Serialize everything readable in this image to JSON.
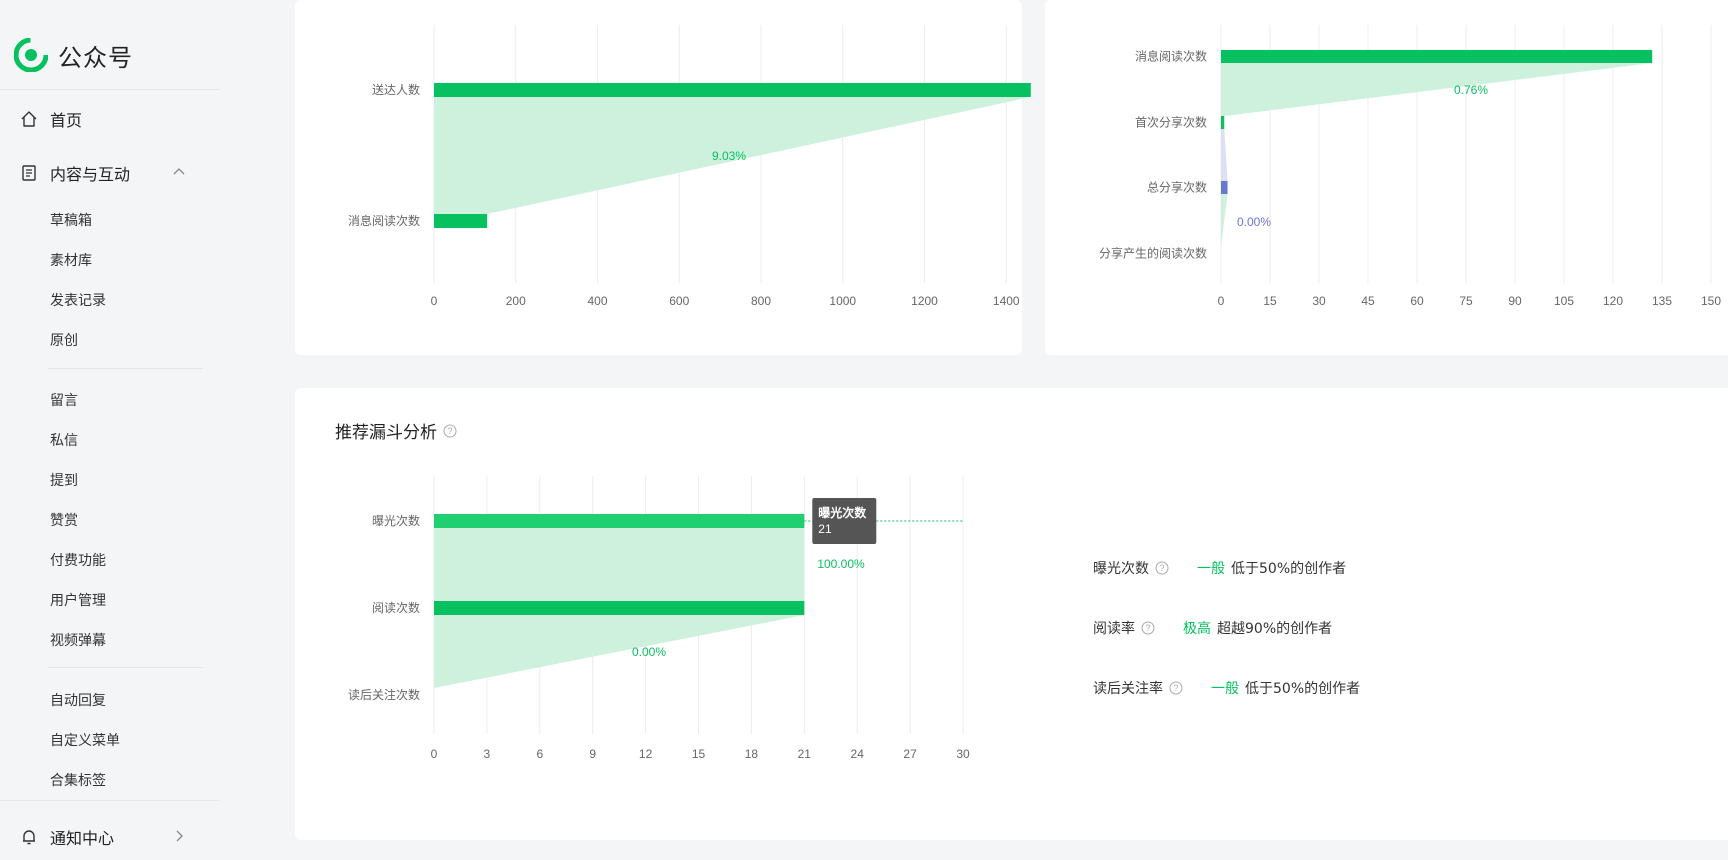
{
  "app": {
    "name": "公众号"
  },
  "colors": {
    "accent": "#07c160",
    "funnel": "#cdf1dc",
    "blue": "#6a77d0",
    "blueFunnel": "#dcdff5"
  },
  "sidebar": {
    "home": "首页",
    "content": "内容与互动",
    "group1": [
      "草稿箱",
      "素材库",
      "发表记录",
      "原创"
    ],
    "group2": [
      "留言",
      "私信",
      "提到",
      "赞赏",
      "付费功能",
      "用户管理",
      "视频弹幕"
    ],
    "group3": [
      "自动回复",
      "自定义菜单",
      "合集标签"
    ],
    "notifications": "通知中心"
  },
  "chart_data": [
    {
      "type": "bar",
      "orientation": "horizontal",
      "categories": [
        "送达人数",
        "消息阅读次数"
      ],
      "values": [
        1460,
        130
      ],
      "xlim": [
        0,
        1600
      ],
      "xticks": [
        0,
        200,
        400,
        600,
        800,
        1000,
        1200,
        1400,
        1600
      ],
      "conversions": [
        "9.03%"
      ]
    },
    {
      "type": "bar",
      "orientation": "horizontal",
      "categories": [
        "消息阅读次数",
        "首次分享次数",
        "总分享次数",
        "分享产生的阅读次数"
      ],
      "values": [
        132,
        1,
        2,
        0
      ],
      "xlim": [
        0,
        150
      ],
      "xticks": [
        0,
        15,
        30,
        45,
        60,
        75,
        90,
        105,
        120,
        135,
        150
      ],
      "conversions": [
        "0.76%",
        "0.00%"
      ]
    },
    {
      "type": "bar",
      "orientation": "horizontal",
      "title": "推荐漏斗分析",
      "categories": [
        "曝光次数",
        "阅读次数",
        "读后关注次数"
      ],
      "values": [
        21,
        21,
        0
      ],
      "xlim": [
        0,
        30
      ],
      "xticks": [
        0,
        3,
        6,
        9,
        12,
        15,
        18,
        21,
        24,
        27,
        30
      ],
      "conversions": [
        "100.00%",
        "0.00%"
      ],
      "tooltip": {
        "label": "曝光次数",
        "value": "21"
      }
    }
  ],
  "recommend": {
    "title": "推荐漏斗分析",
    "metrics": [
      {
        "label": "曝光次数",
        "level": "一般",
        "desc": "低于50%的创作者"
      },
      {
        "label": "阅读率",
        "level": "极高",
        "desc": "超越90%的创作者"
      },
      {
        "label": "读后关注率",
        "level": "一般",
        "desc": "低于50%的创作者"
      }
    ]
  }
}
